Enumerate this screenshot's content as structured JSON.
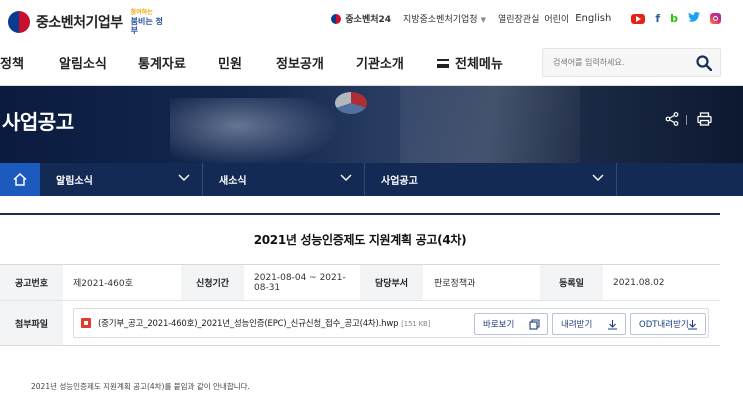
{
  "header": {
    "logo_text": "중소벤처기업부",
    "slogan_line1": "참여하는",
    "slogan_line2": "붐비는 정부",
    "util": {
      "mss24": "중소벤처24",
      "regional": "지방중소벤처기업청",
      "open_office": "열린장관실",
      "kids": "어린이",
      "english": "English"
    },
    "sns": [
      "youtube-icon",
      "facebook-icon",
      "blog-icon",
      "twitter-icon",
      "instagram-icon"
    ],
    "sns_text": {
      "facebook": "f",
      "blog": "b"
    }
  },
  "gnb": {
    "items": [
      "정책",
      "알림소식",
      "통계자료",
      "민원",
      "정보공개",
      "기관소개"
    ],
    "all_menu": "전체메뉴",
    "search_placeholder": "검색어를 입력하세요."
  },
  "banner": {
    "title": "사업공고"
  },
  "location": {
    "items": [
      "알림소식",
      "새소식",
      "사업공고"
    ]
  },
  "post": {
    "title": "2021년 성능인증제도 지원계획 공고(4차)",
    "labels": {
      "number": "공고번호",
      "period": "신청기간",
      "department": "담당부서",
      "date": "등록일",
      "attachment": "첨부파일"
    },
    "number": "제2021-460호",
    "period": "2021-08-04 ~ 2021-08-31",
    "department": "판로정책과",
    "date": "2021.08.02",
    "file": {
      "name": "(중기부_공고_2021-460호)_2021년_성능인증(EPC)_신규신청_접수_공고(4차).hwp",
      "size": "[151 KB]",
      "view": "바로보기",
      "download": "내려받기",
      "odt": "ODT내려받기"
    },
    "description": "2021년 성능인증제도 지원계획 공고(4차)를 붙임과 같이 안내합니다."
  },
  "colors": {
    "nav_dark": "#132a55",
    "home_blue": "#1c5bbd",
    "button_text": "#1a3d7c"
  }
}
